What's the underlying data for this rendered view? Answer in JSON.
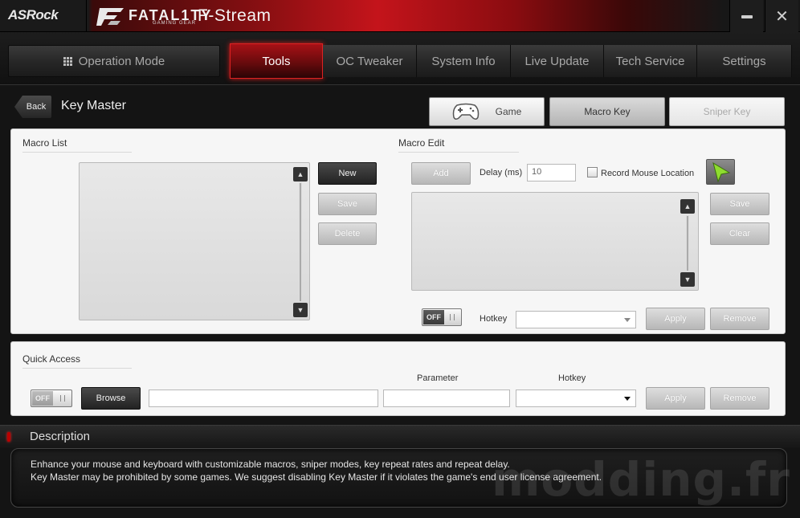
{
  "titlebar": {
    "brand": "ASRock",
    "logo_text": "FATAL1TY",
    "logo_sub": "GAMING GEAR",
    "app_name": "F-Stream"
  },
  "nav": {
    "tabs": [
      {
        "label": "Operation Mode"
      },
      {
        "label": "Tools",
        "active": true
      },
      {
        "label": "OC Tweaker"
      },
      {
        "label": "System Info"
      },
      {
        "label": "Live Update"
      },
      {
        "label": "Tech Service"
      },
      {
        "label": "Settings"
      }
    ]
  },
  "header": {
    "back_label": "Back",
    "page_title": "Key Master",
    "modes": {
      "game": "Game",
      "macro_key": "Macro Key",
      "sniper_key": "Sniper Key"
    }
  },
  "macro_list": {
    "title": "Macro List",
    "new_label": "New",
    "save_label": "Save",
    "delete_label": "Delete"
  },
  "macro_edit": {
    "title": "Macro Edit",
    "add_label": "Add",
    "delay_label": "Delay (ms)",
    "delay_value": "10",
    "record_mouse_label": "Record Mouse Location",
    "save_label": "Save",
    "clear_label": "Clear",
    "toggle_label": "OFF",
    "hotkey_label": "Hotkey",
    "apply_label": "Apply",
    "remove_label": "Remove"
  },
  "quick_access": {
    "title": "Quick Access",
    "toggle_label": "OFF",
    "browse_label": "Browse",
    "parameter_label": "Parameter",
    "hotkey_label": "Hotkey",
    "apply_label": "Apply",
    "remove_label": "Remove"
  },
  "description": {
    "title": "Description",
    "line1": "Enhance your mouse and keyboard with customizable macros, sniper modes, key repeat rates and repeat delay.",
    "line2": "Key Master may be prohibited by some games. We suggest disabling Key Master if it violates the game's end user license agreement.",
    "watermark": "modding.fr"
  },
  "colors": {
    "accent_red": "#c4141b",
    "panel_bg": "#f6f6f6",
    "app_bg": "#141414"
  }
}
